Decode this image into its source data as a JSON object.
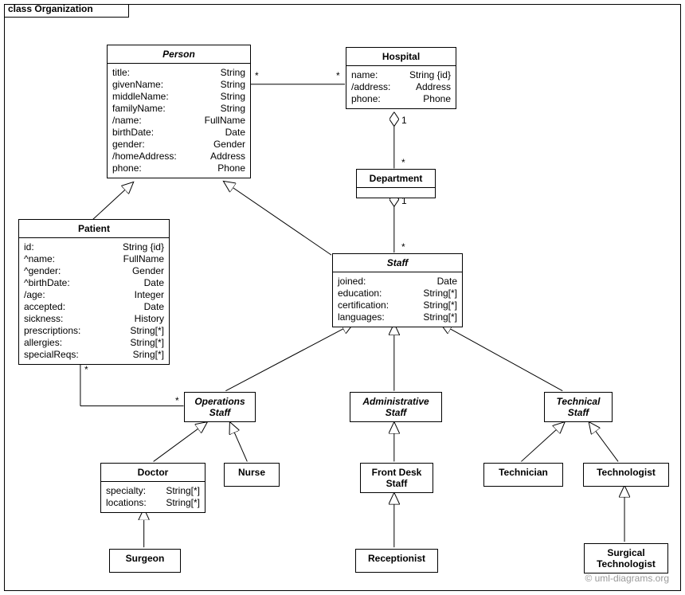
{
  "package": {
    "title": "class Organization"
  },
  "person": {
    "name": "Person",
    "attrs": [
      {
        "k": "title:",
        "t": "String"
      },
      {
        "k": "givenName:",
        "t": "String"
      },
      {
        "k": "middleName:",
        "t": "String"
      },
      {
        "k": "familyName:",
        "t": "String"
      },
      {
        "k": "/name:",
        "t": "FullName"
      },
      {
        "k": "birthDate:",
        "t": "Date"
      },
      {
        "k": "gender:",
        "t": "Gender"
      },
      {
        "k": "/homeAddress:",
        "t": "Address"
      },
      {
        "k": "phone:",
        "t": "Phone"
      }
    ]
  },
  "hospital": {
    "name": "Hospital",
    "attrs": [
      {
        "k": "name:",
        "t": "String {id}"
      },
      {
        "k": "/address:",
        "t": "Address"
      },
      {
        "k": "phone:",
        "t": "Phone"
      }
    ]
  },
  "department": {
    "name": "Department"
  },
  "patient": {
    "name": "Patient",
    "attrs": [
      {
        "k": "id:",
        "t": "String {id}"
      },
      {
        "k": "^name:",
        "t": "FullName"
      },
      {
        "k": "^gender:",
        "t": "Gender"
      },
      {
        "k": "^birthDate:",
        "t": "Date"
      },
      {
        "k": "/age:",
        "t": "Integer"
      },
      {
        "k": "accepted:",
        "t": "Date"
      },
      {
        "k": "sickness:",
        "t": "History"
      },
      {
        "k": "prescriptions:",
        "t": "String[*]"
      },
      {
        "k": "allergies:",
        "t": "String[*]"
      },
      {
        "k": "specialReqs:",
        "t": "Sring[*]"
      }
    ]
  },
  "staff": {
    "name": "Staff",
    "attrs": [
      {
        "k": "joined:",
        "t": "Date"
      },
      {
        "k": "education:",
        "t": "String[*]"
      },
      {
        "k": "certification:",
        "t": "String[*]"
      },
      {
        "k": "languages:",
        "t": "String[*]"
      }
    ]
  },
  "opsStaff": {
    "name": "Operations\nStaff"
  },
  "adminStaff": {
    "name": "Administrative\nStaff"
  },
  "techStaff": {
    "name": "Technical\nStaff"
  },
  "doctor": {
    "name": "Doctor",
    "attrs": [
      {
        "k": "specialty:",
        "t": "String[*]"
      },
      {
        "k": "locations:",
        "t": "String[*]"
      }
    ]
  },
  "nurse": {
    "name": "Nurse"
  },
  "frontDesk": {
    "name": "Front Desk\nStaff"
  },
  "technician": {
    "name": "Technician"
  },
  "technologist": {
    "name": "Technologist"
  },
  "surgeon": {
    "name": "Surgeon"
  },
  "receptionist": {
    "name": "Receptionist"
  },
  "surgTech": {
    "name": "Surgical\nTechnologist"
  },
  "mults": {
    "ph_star_l": "*",
    "ph_star_r": "*",
    "hd_1": "1",
    "hd_star": "*",
    "ds_1": "1",
    "ds_star": "*",
    "po_star_p": "*",
    "po_star_o": "*"
  },
  "footer": "© uml-diagrams.org"
}
